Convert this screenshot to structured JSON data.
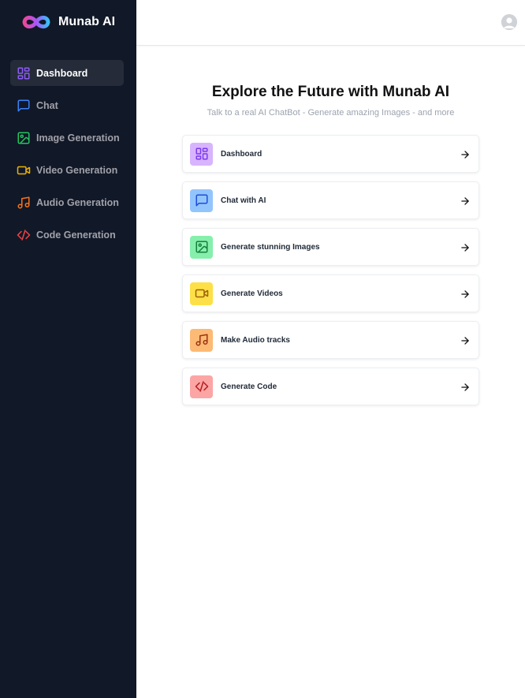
{
  "brand": {
    "name": "Munab AI"
  },
  "sidebar": {
    "items": [
      {
        "label": "Dashboard",
        "icon": "layout-dashboard-icon",
        "color": "#8b5cf6",
        "active": true
      },
      {
        "label": "Chat",
        "icon": "message-square-icon",
        "color": "#3b82f6",
        "active": false
      },
      {
        "label": "Image Generation",
        "icon": "image-icon",
        "color": "#22c55e",
        "active": false
      },
      {
        "label": "Video Generation",
        "icon": "video-icon",
        "color": "#eab308",
        "active": false
      },
      {
        "label": "Audio Generation",
        "icon": "music-icon",
        "color": "#f97316",
        "active": false
      },
      {
        "label": "Code Generation",
        "icon": "code-icon",
        "color": "#ef4444",
        "active": false
      }
    ]
  },
  "header": {
    "avatar_icon": "user-avatar-icon"
  },
  "main": {
    "title": "Explore the Future with Munab AI",
    "subtitle": "Talk to a real AI ChatBot - Generate amazing Images - and more",
    "cards": [
      {
        "label": "Dashboard",
        "icon": "layout-dashboard-icon",
        "color": "#7c3aed",
        "bg": "#d8b4fe"
      },
      {
        "label": "Chat with AI",
        "icon": "message-square-icon",
        "color": "#1d4ed8",
        "bg": "#93c5fd"
      },
      {
        "label": "Generate stunning Images",
        "icon": "image-icon",
        "color": "#15803d",
        "bg": "#86efac"
      },
      {
        "label": "Generate Videos",
        "icon": "video-icon",
        "color": "#a16207",
        "bg": "#fde047"
      },
      {
        "label": "Make Audio tracks",
        "icon": "music-icon",
        "color": "#9a3412",
        "bg": "#fdba74"
      },
      {
        "label": "Generate Code",
        "icon": "code-icon",
        "color": "#b91c1c",
        "bg": "#fca5a5"
      }
    ]
  }
}
